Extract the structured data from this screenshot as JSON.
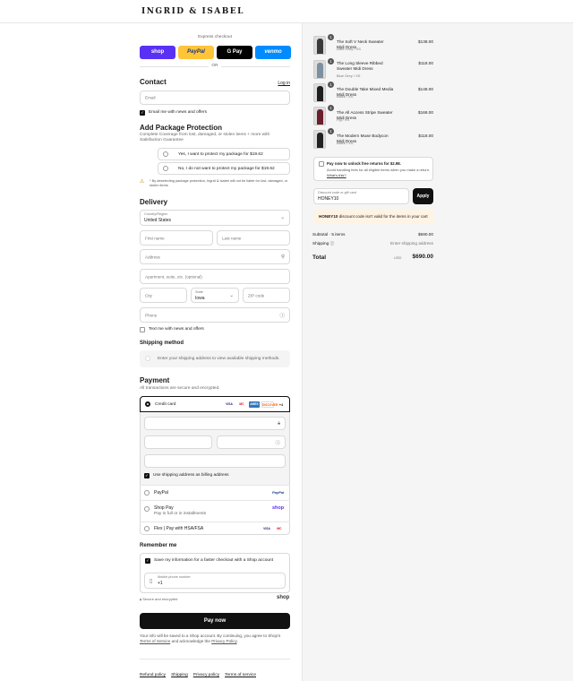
{
  "brand": {
    "logo": "INGRID & ISABEL"
  },
  "express": {
    "title": "Express checkout",
    "buttons": [
      "shop",
      "PayPal",
      "G Pay",
      "venmo"
    ],
    "or": "OR"
  },
  "contact": {
    "title": "Contact",
    "login": "Log in",
    "email_placeholder": "Email",
    "news_label": "Email me with news and offers"
  },
  "protection": {
    "title": "Add Package Protection",
    "desc": "Complete Coverage from lost, damaged, or stolen items + more with Satisfaction Guarantee",
    "yes": "Yes, I want to protect my package for $19.62",
    "no": "No, I do not want to protect my package for $19.62",
    "warning": "* By deselecting package protection, Ingrid & Isabel will not be liable for lost, damaged, or stolen items"
  },
  "delivery": {
    "title": "Delivery",
    "country_label": "Country/Region",
    "country": "United States",
    "first": "First name",
    "last": "Last name",
    "address": "Address",
    "apt": "Apartment, suite, etc. (optional)",
    "city": "City",
    "state_label": "State",
    "state": "Iowa",
    "zip": "ZIP code",
    "phone": "Phone",
    "text_label": "Text me with news and offers"
  },
  "shipping": {
    "title": "Shipping method",
    "note": "Enter your shipping address to view available shipping methods."
  },
  "payment": {
    "title": "Payment",
    "desc": "All transactions are secure and encrypted.",
    "credit": "Credit card",
    "card_logos": [
      "VISA",
      "MC",
      "AMEX",
      "DISCOVER"
    ],
    "more": "+4",
    "billing_label": "Use shipping address as billing address",
    "paypal": "PayPal",
    "paypal_logo": "PayPal",
    "shoppay": "Shop Pay",
    "shoppay_sub": "Pay in full or in installments",
    "shoppay_logo": "shop",
    "flex": "Flex | Pay with HSA/FSA",
    "flex_logos": [
      "VISA",
      "MC"
    ]
  },
  "remember": {
    "title": "Remember me",
    "save_label": "Save my information for a faster checkout with a Shop account",
    "mobile_label": "Mobile phone number",
    "mobile_value": "+1",
    "secure": "Secure and encrypted",
    "shop": "shop"
  },
  "paynow": "Pay now",
  "legal": {
    "pre": "Your info will be saved to a Shop account. By continuing, you agree to Shop's ",
    "tos": "Terms of Service",
    "mid": " and acknowledge the ",
    "privacy": "Privacy Policy",
    "end": "."
  },
  "footer": [
    "Refund policy",
    "Shipping",
    "Privacy policy",
    "Terms of service"
  ],
  "cart": {
    "items": [
      {
        "qty": "1",
        "name": "The Soft V Neck Sweater Midi Dress",
        "variant": "Dark Grey / XS",
        "price": "$138.00",
        "color": "#3a3a3a"
      },
      {
        "qty": "1",
        "name": "The Long Sleeve Ribbed Sweater Midi Dress",
        "variant": "Blue Grey / XS",
        "price": "$118.00",
        "color": "#7d8fa0"
      },
      {
        "qty": "1",
        "name": "The Double Take Mixed Media Midi Dress",
        "variant": "Black / XS",
        "price": "$148.00",
        "color": "#1e1e1e"
      },
      {
        "qty": "1",
        "name": "The All Access Stripe Sweater Midi Dress",
        "variant": "Fig / XS",
        "price": "$168.00",
        "color": "#6b1f2b"
      },
      {
        "qty": "1",
        "name": "The Modern Muse Bodycon Midi Dress",
        "variant": "Black / XS",
        "price": "$118.00",
        "color": "#222"
      }
    ],
    "returns_title": "Pay now to unlock free returns for $2.98.",
    "returns_desc": "Avoid handling fees for all eligible items when you make a return.",
    "returns_link": "What's this?",
    "discount_label": "Discount code or gift card",
    "discount_value": "HONEY10",
    "apply": "Apply",
    "error_code": "HONEY10",
    "error_msg": " discount code isn't valid for the items in your cart",
    "subtotal_label": "Subtotal · 5 items",
    "subtotal": "$690.00",
    "shipping_label": "Shipping",
    "shipping_value": "Enter shipping address",
    "total_label": "Total",
    "currency": "USD",
    "total": "$690.00"
  }
}
